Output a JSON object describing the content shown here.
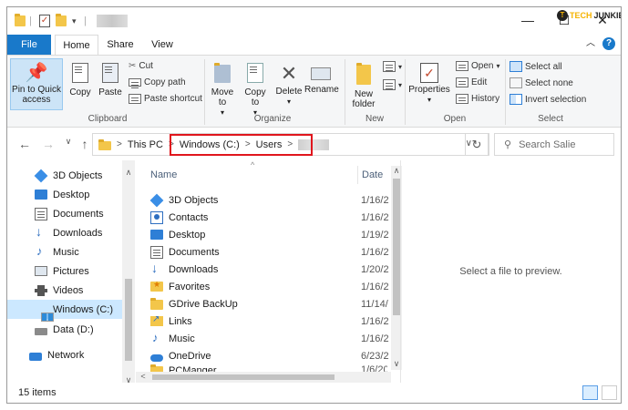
{
  "window": {
    "title_blurred": "",
    "brand_prefix": "TECH",
    "brand_suffix": "JUNKIE"
  },
  "ribbon_tabs": [
    "File",
    "Home",
    "Share",
    "View"
  ],
  "ribbon": {
    "clipboard": {
      "pin": "Pin to Quick access",
      "copy": "Copy",
      "paste": "Paste",
      "cut": "Cut",
      "copy_path": "Copy path",
      "paste_shortcut": "Paste shortcut",
      "label": "Clipboard"
    },
    "organize": {
      "move_to": "Move to",
      "copy_to": "Copy to",
      "delete": "Delete",
      "rename": "Rename",
      "label": "Organize"
    },
    "new": {
      "new_folder": "New folder",
      "label": "New"
    },
    "open": {
      "properties": "Properties",
      "open": "Open",
      "edit": "Edit",
      "history": "History",
      "label": "Open"
    },
    "select": {
      "select_all": "Select all",
      "select_none": "Select none",
      "invert": "Invert selection",
      "label": "Select"
    }
  },
  "address": {
    "crumbs": [
      "This PC",
      "Windows (C:)",
      "Users"
    ],
    "search_placeholder": "Search Salie"
  },
  "nav_pane": [
    {
      "label": "3D Objects",
      "icon": "cube-icon"
    },
    {
      "label": "Desktop",
      "icon": "desktop-icon"
    },
    {
      "label": "Documents",
      "icon": "documents-icon"
    },
    {
      "label": "Downloads",
      "icon": "download-icon"
    },
    {
      "label": "Music",
      "icon": "music-icon"
    },
    {
      "label": "Pictures",
      "icon": "pictures-icon"
    },
    {
      "label": "Videos",
      "icon": "videos-icon"
    },
    {
      "label": "Windows (C:)",
      "icon": "windows-drive-icon",
      "selected": true
    },
    {
      "label": "Data (D:)",
      "icon": "drive-icon"
    },
    {
      "label": "Network",
      "icon": "network-icon"
    }
  ],
  "file_list": {
    "columns": [
      "Name",
      "Date"
    ],
    "rows": [
      {
        "name": "3D Objects",
        "date": "1/16/2",
        "icon": "cube-icon"
      },
      {
        "name": "Contacts",
        "date": "1/16/2",
        "icon": "contacts-icon"
      },
      {
        "name": "Desktop",
        "date": "1/19/2",
        "icon": "desktop-icon"
      },
      {
        "name": "Documents",
        "date": "1/16/2",
        "icon": "documents-icon"
      },
      {
        "name": "Downloads",
        "date": "1/20/2",
        "icon": "download-icon"
      },
      {
        "name": "Favorites",
        "date": "1/16/2",
        "icon": "favorites-icon"
      },
      {
        "name": "GDrive BackUp",
        "date": "11/14/",
        "icon": "folder-icon"
      },
      {
        "name": "Links",
        "date": "1/16/2",
        "icon": "links-icon"
      },
      {
        "name": "Music",
        "date": "1/16/2",
        "icon": "music-icon"
      },
      {
        "name": "OneDrive",
        "date": "6/23/2",
        "icon": "onedrive-icon"
      },
      {
        "name": "PCManger",
        "date": "1/6/20",
        "icon": "folder-icon"
      }
    ]
  },
  "preview_text": "Select a file to preview.",
  "status": {
    "count": "15 items"
  }
}
